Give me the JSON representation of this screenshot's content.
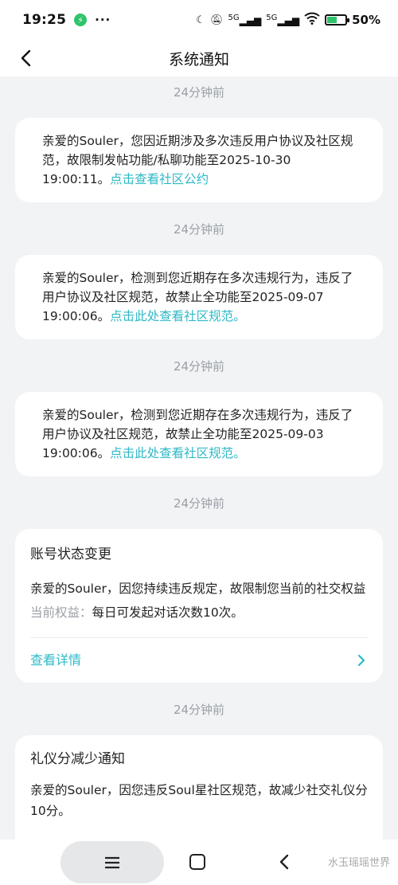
{
  "status_bar": {
    "time": "19:25",
    "dots": "···",
    "sig1": "5G",
    "sig2": "5G",
    "battery_text": "50%"
  },
  "header": {
    "title": "系统通知"
  },
  "notifications": [
    {
      "time": "24分钟前",
      "text": "亲爱的Souler，您因近期涉及多次违反用户协议及社区规范，故限制发帖功能/私聊功能至2025-10-30 19:00:11。",
      "link": "点击查看社区公约"
    },
    {
      "time": "24分钟前",
      "text": "亲爱的Souler，检测到您近期存在多次违规行为，违反了用户协议及社区规范，故禁止全功能至2025-09-07 19:00:06。",
      "link": "点击此处查看社区规范。"
    },
    {
      "time": "24分钟前",
      "text": "亲爱的Souler，检测到您近期存在多次违规行为，违反了用户协议及社区规范，故禁止全功能至2025-09-03 19:00:06。",
      "link": "点击此处查看社区规范。"
    }
  ],
  "status_change": {
    "time": "24分钟前",
    "title": "账号状态变更",
    "text": "亲爱的Souler，因您持续违反规定，故限制您当前的社交权益",
    "rights_label": "当前权益：",
    "rights_value": "每日可发起对话次数10次。",
    "details": "查看详情"
  },
  "etiquette": {
    "time": "24分钟前",
    "title": "礼仪分减少通知",
    "text": "亲爱的Souler，因您违反Soul星社区规范，故减少社交礼仪分10分。"
  },
  "watermark": "水玉瑶瑶世界",
  "colors": {
    "accent": "#2db9c6",
    "muted": "#9aa0a6",
    "background": "#f2f3f5"
  }
}
